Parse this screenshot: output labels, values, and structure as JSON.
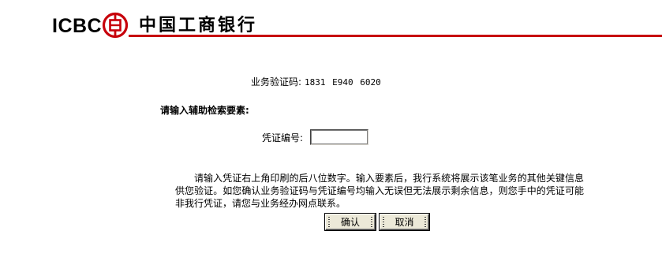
{
  "header": {
    "logo_text": "ICBC",
    "bank_name": "中国工商银行",
    "brand_color": "#c7000b"
  },
  "verification": {
    "label": "业务验证码:",
    "code": "1831 E940 6020"
  },
  "search": {
    "title": "请输入辅助检索要素:",
    "voucher_label": "凭证编号:",
    "voucher_value": ""
  },
  "notice": "请输入凭证右上角印刷的后八位数字。输入要素后，我行系统将展示该笔业务的其他关键信息供您验证。如您确认业务验证码与凭证编号均输入无误但无法展示剩余信息，则您手中的凭证可能非我行凭证，请您与业务经办网点联系。",
  "buttons": {
    "confirm": "确认",
    "cancel": "取消"
  }
}
